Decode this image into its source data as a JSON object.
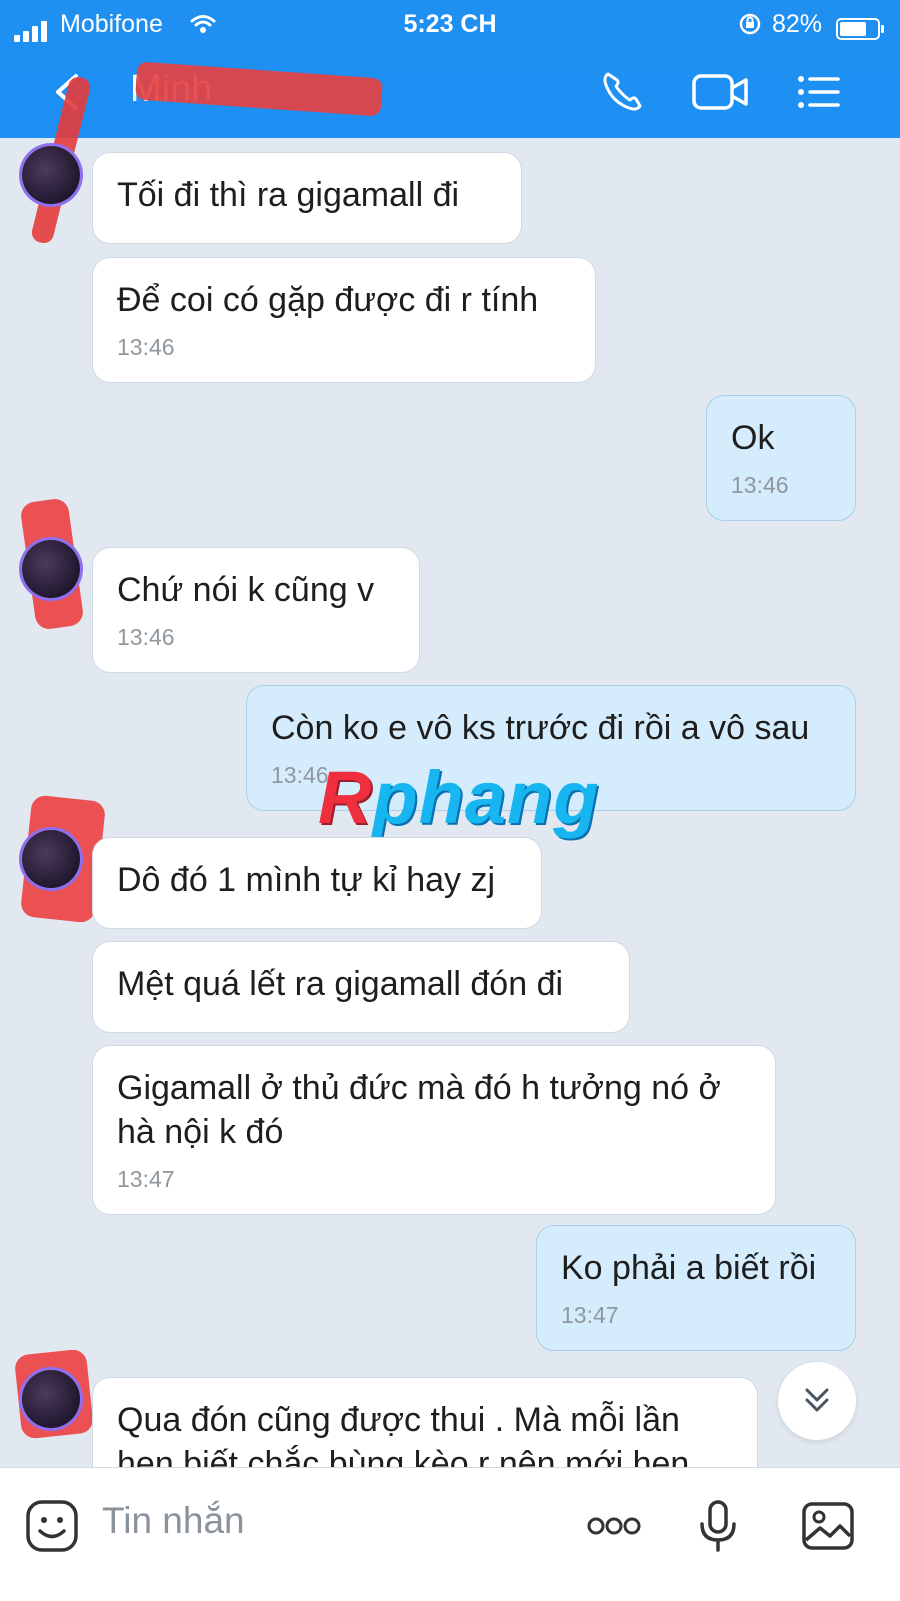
{
  "status_bar": {
    "carrier": "Mobifone",
    "time": "5:23 CH",
    "battery_percent": "82%",
    "battery_level": 0.82
  },
  "header": {
    "contact_name": "Minh",
    "icons": [
      "chevron-left-icon",
      "phone-icon",
      "video-camera-icon",
      "menu-list-icon"
    ]
  },
  "messages": [
    {
      "side": "in",
      "text": "Tối đi thì ra gigamall đi",
      "time": ""
    },
    {
      "side": "in",
      "text": "Để coi có gặp được đi r tính",
      "time": "13:46"
    },
    {
      "side": "out",
      "text": "Ok",
      "time": "13:46"
    },
    {
      "side": "in",
      "text": "Chứ nói k cũng v",
      "time": "13:46"
    },
    {
      "side": "out",
      "text": "Còn ko e vô ks trước đi rồi a vô sau",
      "time": "13:46"
    },
    {
      "side": "in",
      "text": "Dô đó 1 mình tự kỉ hay zj",
      "time": ""
    },
    {
      "side": "in",
      "text": "Mệt quá lết ra gigamall đón đi",
      "time": ""
    },
    {
      "side": "in",
      "text": "Gigamall ở thủ đức mà đó h tưởng nó ở hà nội k đó",
      "time": "13:47"
    },
    {
      "side": "out",
      "text": "Ko phải a biết rồi",
      "time": "13:47"
    },
    {
      "side": "in",
      "text": "Qua đón cũng được thui . Mà mỗi lần hẹn biết chắc bùng kèo r nên mới hẹn",
      "time": ""
    }
  ],
  "watermark": {
    "first": "R",
    "rest": "phang"
  },
  "composer": {
    "placeholder": "Tin nhắn",
    "icons": [
      "sticker-icon",
      "more-dots-icon",
      "microphone-icon",
      "image-icon"
    ]
  },
  "colors": {
    "header": "#1e90f5",
    "incoming": "#ffffff",
    "outgoing": "#d4ecfc",
    "background": "#e2e8f0"
  }
}
